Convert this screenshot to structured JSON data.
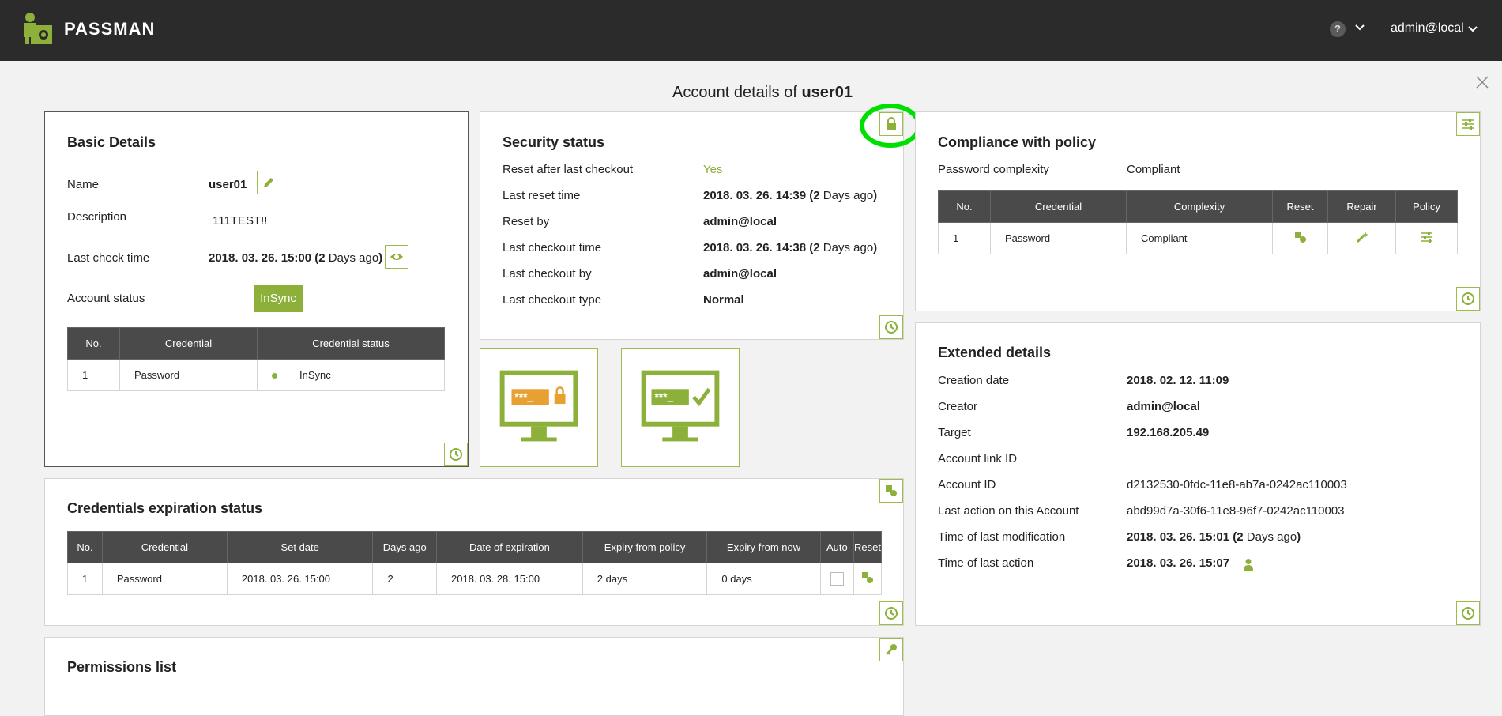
{
  "app": {
    "brand": "PASSMAN",
    "help_label": "?",
    "user": "admin@local"
  },
  "title": {
    "prefix": "Account details of",
    "account": "user01"
  },
  "basic": {
    "title": "Basic Details",
    "name_label": "Name",
    "name": "user01",
    "desc_label": "Description",
    "desc": "111TEST!!",
    "check_label": "Last check time",
    "check_date": "2018. 03. 26. 15:00",
    "check_ago_n": "2",
    "check_ago": "Days ago",
    "status_label": "Account status",
    "status": "InSync",
    "table_headers": [
      "No.",
      "Credential",
      "Credential status"
    ],
    "rows": [
      {
        "no": "1",
        "credential": "Password",
        "status": "InSync"
      }
    ]
  },
  "security": {
    "title": "Security status",
    "items": [
      {
        "label": "Reset after last checkout",
        "value": "Yes"
      },
      {
        "label": "Last reset time",
        "value": "2018. 03. 26. 14:39",
        "ago_n": "2",
        "ago": "Days ago"
      },
      {
        "label": "Reset by",
        "value": "admin@local"
      },
      {
        "label": "Last checkout time",
        "value": "2018. 03. 26. 14:38",
        "ago_n": "2",
        "ago": "Days ago"
      },
      {
        "label": "Last checkout by",
        "value": "admin@local"
      },
      {
        "label": "Last checkout type",
        "value": "Normal"
      }
    ],
    "tile1_text": "***_",
    "tile2_text": "***_"
  },
  "compliance": {
    "title": "Compliance with policy",
    "pc_label": "Password complexity",
    "pc_value": "Compliant",
    "table_headers": [
      "No.",
      "Credential",
      "Complexity",
      "Reset",
      "Repair",
      "Policy"
    ],
    "rows": [
      {
        "no": "1",
        "credential": "Password",
        "complexity": "Compliant"
      }
    ]
  },
  "extended": {
    "title": "Extended details",
    "items": [
      {
        "label": "Creation date",
        "value": "2018. 02. 12. 11:09"
      },
      {
        "label": "Creator",
        "value": "admin@local"
      },
      {
        "label": "Target",
        "value": "192.168.205.49"
      },
      {
        "label": "Account link ID",
        "value": ""
      },
      {
        "label": "Account ID",
        "value": "d2132530-0fdc-11e8-ab7a-0242ac110003"
      },
      {
        "label": "Last action on this Account",
        "value": "abd99d7a-30f6-11e8-96f7-0242ac110003"
      },
      {
        "label": "Time of last modification",
        "value": "2018. 03. 26. 15:01",
        "ago_n": "2",
        "ago": "Days ago"
      },
      {
        "label": "Time of last action",
        "value": "2018. 03. 26. 15:07"
      }
    ]
  },
  "expiration": {
    "title": "Credentials expiration status",
    "table_headers": [
      "No.",
      "Credential",
      "Set date",
      "Days ago",
      "Date of expiration",
      "Expiry from policy",
      "Expiry from now",
      "Auto",
      "Reset"
    ],
    "rows": [
      {
        "no": "1",
        "credential": "Password",
        "set_date": "2018. 03. 26. 15:00",
        "days_ago": "2",
        "expiration": "2018. 03. 28. 15:00",
        "from_policy": "2 days",
        "from_now": "0 days"
      }
    ]
  },
  "permissions": {
    "title": "Permissions list"
  },
  "colors": {
    "accent": "#8cb03a",
    "topbar": "#2b2b2b",
    "table_header": "#4a4a4a",
    "highlight": "#00e000"
  }
}
